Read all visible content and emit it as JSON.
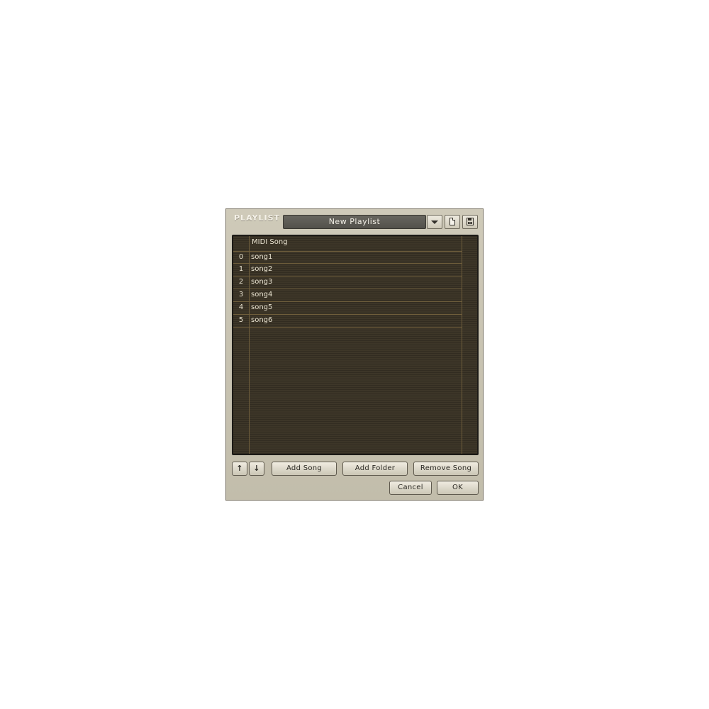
{
  "window": {
    "title": "PLAYLIST",
    "playlist_name": "New Playlist"
  },
  "icons": {
    "dropdown": "triangle-down-icon",
    "new_playlist": "new-page-icon",
    "save_playlist": "floppy-disk-icon",
    "move_up": "arrow-up-icon",
    "move_down": "arrow-down-icon"
  },
  "table": {
    "column_header": "MIDI Song",
    "rows": [
      {
        "index": "0",
        "song": "song1"
      },
      {
        "index": "1",
        "song": "song2"
      },
      {
        "index": "2",
        "song": "song3"
      },
      {
        "index": "3",
        "song": "song4"
      },
      {
        "index": "4",
        "song": "song5"
      },
      {
        "index": "5",
        "song": "song6"
      }
    ]
  },
  "buttons": {
    "up": "↑",
    "down": "↓",
    "add_song": "Add Song",
    "add_folder": "Add Folder",
    "remove_song": "Remove Song",
    "cancel": "Cancel",
    "ok": "OK"
  },
  "colors": {
    "panel_background": "#c7c2b0",
    "list_background": "#3d3628",
    "grid_line": "#6f5e3c",
    "list_text": "#e8e2d0"
  }
}
